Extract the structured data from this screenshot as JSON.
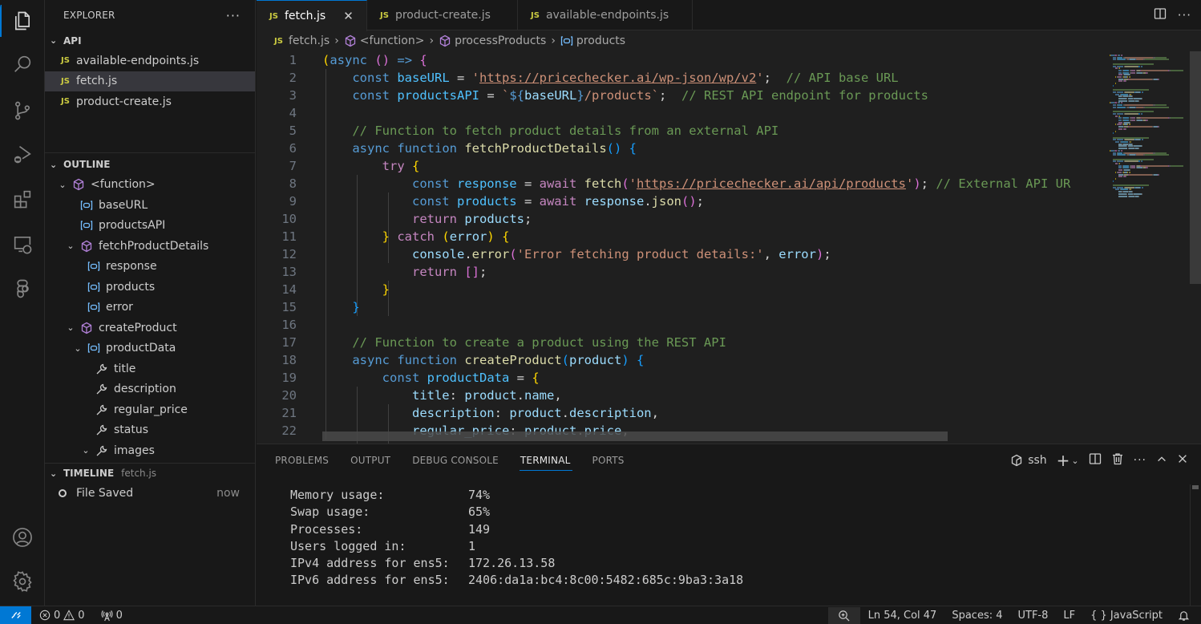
{
  "activity_bar": {
    "items": [
      {
        "name": "explorer",
        "icon": "files-icon",
        "active": true
      },
      {
        "name": "search",
        "icon": "search-icon"
      },
      {
        "name": "source-control",
        "icon": "source-control-icon"
      },
      {
        "name": "run-debug",
        "icon": "run-debug-icon"
      },
      {
        "name": "extensions",
        "icon": "extensions-icon"
      },
      {
        "name": "remote-explorer",
        "icon": "remote-explorer-icon"
      },
      {
        "name": "figma",
        "icon": "figma-icon"
      }
    ],
    "bottom": [
      {
        "name": "accounts",
        "icon": "account-icon"
      },
      {
        "name": "manage",
        "icon": "gear-icon"
      }
    ]
  },
  "explorer": {
    "title": "EXPLORER",
    "more": "···",
    "folder": "API",
    "files": [
      {
        "badge": "JS",
        "name": "available-endpoints.js",
        "selected": false
      },
      {
        "badge": "JS",
        "name": "fetch.js",
        "selected": true
      },
      {
        "badge": "JS",
        "name": "product-create.js",
        "selected": false
      }
    ]
  },
  "outline": {
    "title": "OUTLINE",
    "items": [
      {
        "label": "<function>",
        "kind": "function",
        "expanded": true
      },
      {
        "label": "baseURL",
        "kind": "variable"
      },
      {
        "label": "productsAPI",
        "kind": "variable"
      },
      {
        "label": "fetchProductDetails",
        "kind": "function",
        "expanded": true
      },
      {
        "label": "response",
        "kind": "variable"
      },
      {
        "label": "products",
        "kind": "variable"
      },
      {
        "label": "error",
        "kind": "variable"
      },
      {
        "label": "createProduct",
        "kind": "function",
        "expanded": true
      },
      {
        "label": "productData",
        "kind": "variable",
        "expanded": true
      },
      {
        "label": "title",
        "kind": "property"
      },
      {
        "label": "description",
        "kind": "property"
      },
      {
        "label": "regular_price",
        "kind": "property"
      },
      {
        "label": "status",
        "kind": "property"
      },
      {
        "label": "images",
        "kind": "property",
        "expanded": true
      }
    ]
  },
  "timeline": {
    "title": "TIMELINE",
    "file": "fetch.js",
    "entries": [
      {
        "label": "File Saved",
        "when": "now"
      }
    ]
  },
  "tabs": [
    {
      "badge": "JS",
      "label": "fetch.js",
      "active": true,
      "close": "✕"
    },
    {
      "badge": "JS",
      "label": "product-create.js",
      "active": false
    },
    {
      "badge": "JS",
      "label": "available-endpoints.js",
      "active": false
    }
  ],
  "breadcrumbs": [
    {
      "label": "fetch.js",
      "icon": "js-file-icon"
    },
    {
      "label": "<function>",
      "icon": "function-cube-icon"
    },
    {
      "label": "processProducts",
      "icon": "function-cube-icon"
    },
    {
      "label": "products",
      "icon": "variable-icon"
    }
  ],
  "code_lines": [
    {
      "n": "1"
    },
    {
      "n": "2"
    },
    {
      "n": "3"
    },
    {
      "n": "4"
    },
    {
      "n": "5"
    },
    {
      "n": "6"
    },
    {
      "n": "7"
    },
    {
      "n": "8"
    },
    {
      "n": "9"
    },
    {
      "n": "10"
    },
    {
      "n": "11"
    },
    {
      "n": "12"
    },
    {
      "n": "13"
    },
    {
      "n": "14"
    },
    {
      "n": "15"
    },
    {
      "n": "16"
    },
    {
      "n": "17"
    },
    {
      "n": "18"
    },
    {
      "n": "19"
    },
    {
      "n": "20"
    },
    {
      "n": "21"
    },
    {
      "n": "22"
    }
  ],
  "code_tokens": {
    "l1": [
      [
        "b1",
        "("
      ],
      [
        "k1",
        "async"
      ],
      [
        "p",
        " "
      ],
      [
        "b2",
        "()"
      ],
      [
        "p",
        " "
      ],
      [
        "k1",
        "=>"
      ],
      [
        "p",
        " "
      ],
      [
        "b2",
        "{"
      ]
    ],
    "l2": [
      [
        "k1",
        "    const"
      ],
      [
        "p",
        " "
      ],
      [
        "vc",
        "baseURL"
      ],
      [
        "p",
        " = "
      ],
      [
        "s",
        "'"
      ],
      [
        "su",
        "https://pricechecker.ai/wp-json/wp/v2"
      ],
      [
        "s",
        "'"
      ],
      [
        "p",
        ";  "
      ],
      [
        "c",
        "// API base URL"
      ]
    ],
    "l3": [
      [
        "k1",
        "    const"
      ],
      [
        "p",
        " "
      ],
      [
        "vc",
        "productsAPI"
      ],
      [
        "p",
        " = "
      ],
      [
        "s",
        "`"
      ],
      [
        "k1",
        "${"
      ],
      [
        "v",
        "baseURL"
      ],
      [
        "k1",
        "}"
      ],
      [
        "s",
        "/products`"
      ],
      [
        "p",
        ";  "
      ],
      [
        "c",
        "// REST API endpoint for products"
      ]
    ],
    "l4": [],
    "l5": [
      [
        "c",
        "    // Function to fetch product details from an external API"
      ]
    ],
    "l6": [
      [
        "k1",
        "    async"
      ],
      [
        "p",
        " "
      ],
      [
        "k1",
        "function"
      ],
      [
        "p",
        " "
      ],
      [
        "fn",
        "fetchProductDetails"
      ],
      [
        "b3",
        "()"
      ],
      [
        "p",
        " "
      ],
      [
        "b3",
        "{"
      ]
    ],
    "l7": [
      [
        "k2",
        "        try"
      ],
      [
        "p",
        " "
      ],
      [
        "b1",
        "{"
      ]
    ],
    "l8": [
      [
        "k1",
        "            const"
      ],
      [
        "p",
        " "
      ],
      [
        "vc",
        "response"
      ],
      [
        "p",
        " = "
      ],
      [
        "k2",
        "await"
      ],
      [
        "p",
        " "
      ],
      [
        "fn",
        "fetch"
      ],
      [
        "b2",
        "("
      ],
      [
        "s",
        "'"
      ],
      [
        "su",
        "https://pricechecker.ai/api/products"
      ],
      [
        "s",
        "'"
      ],
      [
        "b2",
        ")"
      ],
      [
        "p",
        "; "
      ],
      [
        "c",
        "// External API UR"
      ]
    ],
    "l9": [
      [
        "k1",
        "            const"
      ],
      [
        "p",
        " "
      ],
      [
        "vc",
        "products"
      ],
      [
        "p",
        " = "
      ],
      [
        "k2",
        "await"
      ],
      [
        "p",
        " "
      ],
      [
        "v",
        "response"
      ],
      [
        "p",
        "."
      ],
      [
        "fn",
        "json"
      ],
      [
        "b2",
        "()"
      ],
      [
        "p",
        ";"
      ]
    ],
    "l10": [
      [
        "k2",
        "            return"
      ],
      [
        "p",
        " "
      ],
      [
        "v",
        "products"
      ],
      [
        "p",
        ";"
      ]
    ],
    "l11": [
      [
        "b1",
        "        }"
      ],
      [
        "p",
        " "
      ],
      [
        "k2",
        "catch"
      ],
      [
        "p",
        " "
      ],
      [
        "b1",
        "("
      ],
      [
        "v",
        "error"
      ],
      [
        "b1",
        ")"
      ],
      [
        "p",
        " "
      ],
      [
        "b1",
        "{"
      ]
    ],
    "l12": [
      [
        "v",
        "            console"
      ],
      [
        "p",
        "."
      ],
      [
        "fn",
        "error"
      ],
      [
        "b2",
        "("
      ],
      [
        "s",
        "'Error fetching product details:'"
      ],
      [
        "p",
        ", "
      ],
      [
        "v",
        "error"
      ],
      [
        "b2",
        ")"
      ],
      [
        "p",
        ";"
      ]
    ],
    "l13": [
      [
        "k2",
        "            return"
      ],
      [
        "p",
        " "
      ],
      [
        "b2",
        "[]"
      ],
      [
        "p",
        ";"
      ]
    ],
    "l14": [
      [
        "b1",
        "        }"
      ]
    ],
    "l15": [
      [
        "b3",
        "    }"
      ]
    ],
    "l16": [],
    "l17": [
      [
        "c",
        "    // Function to create a product using the REST API"
      ]
    ],
    "l18": [
      [
        "k1",
        "    async"
      ],
      [
        "p",
        " "
      ],
      [
        "k1",
        "function"
      ],
      [
        "p",
        " "
      ],
      [
        "fn",
        "createProduct"
      ],
      [
        "b3",
        "("
      ],
      [
        "v",
        "product"
      ],
      [
        "b3",
        ")"
      ],
      [
        "p",
        " "
      ],
      [
        "b3",
        "{"
      ]
    ],
    "l19": [
      [
        "k1",
        "        const"
      ],
      [
        "p",
        " "
      ],
      [
        "vc",
        "productData"
      ],
      [
        "p",
        " = "
      ],
      [
        "b1",
        "{"
      ]
    ],
    "l20": [
      [
        "v",
        "            title"
      ],
      [
        "p",
        ": "
      ],
      [
        "v",
        "product"
      ],
      [
        "p",
        "."
      ],
      [
        "v",
        "name"
      ],
      [
        "p",
        ","
      ]
    ],
    "l21": [
      [
        "v",
        "            description"
      ],
      [
        "p",
        ": "
      ],
      [
        "v",
        "product"
      ],
      [
        "p",
        "."
      ],
      [
        "v",
        "description"
      ],
      [
        "p",
        ","
      ]
    ],
    "l22": [
      [
        "v",
        "            regular_price"
      ],
      [
        "p",
        ": "
      ],
      [
        "v",
        "product"
      ],
      [
        "p",
        "."
      ],
      [
        "v",
        "price"
      ],
      [
        "p",
        ","
      ]
    ]
  },
  "panel": {
    "tabs": [
      "PROBLEMS",
      "OUTPUT",
      "DEBUG CONSOLE",
      "TERMINAL",
      "PORTS"
    ],
    "active_tab": "TERMINAL",
    "terminal_profile": "ssh",
    "terminal_lines": [
      {
        "label": "Memory usage:",
        "value": "74%"
      },
      {
        "label": "Swap usage:",
        "value": "65%"
      },
      {
        "label": "Processes:",
        "value": "149"
      },
      {
        "label": "Users logged in:",
        "value": "1"
      },
      {
        "label": "IPv4 address for ens5:",
        "value": "172.26.13.58"
      },
      {
        "label": "IPv6 address for ens5:",
        "value": "2406:da1a:bc4:8c00:5482:685c:9ba3:3a18"
      }
    ]
  },
  "status_bar": {
    "errors": "0",
    "warnings": "0",
    "ports": "0",
    "cursor": "Ln 54, Col 47",
    "indent": "Spaces: 4",
    "encoding": "UTF-8",
    "eol": "LF",
    "language": "JavaScript",
    "language_icon": "{ }"
  },
  "colors": {
    "accent": "#0078d4",
    "js_badge": "#cbcb41",
    "function_icon": "#b180d7",
    "variable_icon": "#75beff"
  }
}
